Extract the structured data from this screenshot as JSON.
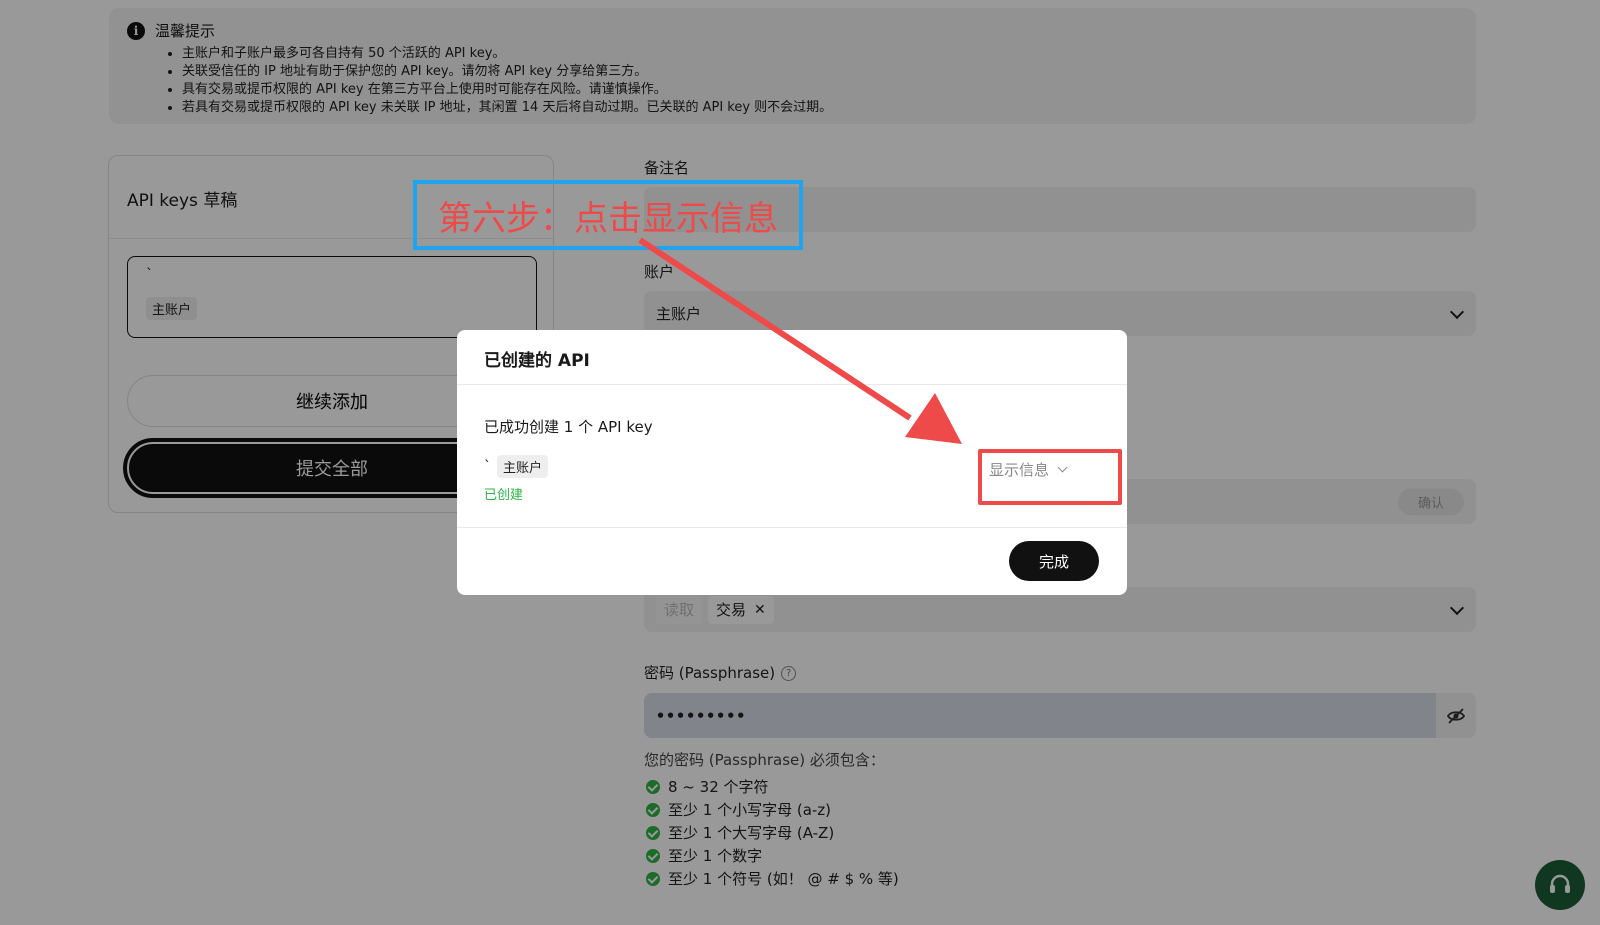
{
  "notice": {
    "title": "温馨提示",
    "items": [
      "主账户和子账户最多可各自持有 50 个活跃的 API key。",
      "关联受信任的 IP 地址有助于保护您的 API key。请勿将 API key 分享给第三方。",
      "具有交易或提币权限的 API key 在第三方平台上使用时可能存在风险。请谨慎操作。",
      "若具有交易或提币权限的 API key 未关联 IP 地址，其闲置 14 天后将自动过期。已关联的 API key 则不会过期。"
    ]
  },
  "drafts": {
    "title": "API keys 草稿",
    "card": {
      "name": "`",
      "account_tag": "主账户"
    },
    "continue_label": "继续添加",
    "submit_label": "提交全部"
  },
  "form": {
    "remark_label": "备注名",
    "account_label": "账户",
    "account_value": "主账户",
    "confirm_label": "确认",
    "permissions": [
      {
        "label": "读取",
        "disabled": true
      },
      {
        "label": "交易",
        "disabled": false,
        "removable": "✕"
      }
    ],
    "passphrase_label": "密码 (Passphrase)",
    "passphrase_help": "?",
    "passphrase_value": "•••••••••",
    "rules_title": "您的密码 (Passphrase) 必须包含：",
    "rules": [
      "8 ~ 32 个字符",
      "至少 1 个小写字母 (a-z)",
      "至少 1 个大写字母 (A-Z)",
      "至少 1 个数字",
      "至少 1 个符号 (如！ @ # $ % 等)"
    ]
  },
  "modal": {
    "title": "已创建的 API",
    "message": "已成功创建 1 个 API key",
    "item_name": "`",
    "item_tag": "主账户",
    "item_status": "已创建",
    "show_info_label": "显示信息",
    "done_label": "完成"
  },
  "annotation": {
    "step_text": "第六步：点击显示信息"
  },
  "colors": {
    "accent_green": "#2fb344",
    "annotation_red": "#ee4a4a",
    "annotation_blue": "#1fa5f0",
    "support_green": "#1c5e36"
  },
  "icons": [
    "info-icon",
    "chevron-down-icon",
    "eye-slash-icon",
    "help-icon",
    "check-icon",
    "headset-icon",
    "close-icon"
  ]
}
